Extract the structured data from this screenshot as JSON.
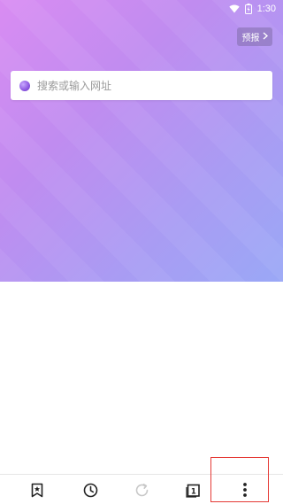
{
  "status_bar": {
    "time": "1:30",
    "icons": [
      "wifi-icon",
      "battery-icon"
    ]
  },
  "header": {
    "forecast_label": "预报",
    "forecast_icon": "chevron-right-icon"
  },
  "search": {
    "placeholder": "搜索或输入网址",
    "logo_icon": "purple-orb-icon"
  },
  "bottom_nav": {
    "items": [
      {
        "name": "bookmarks",
        "icon": "bookmark-star-icon",
        "enabled": true
      },
      {
        "name": "history",
        "icon": "clock-icon",
        "enabled": true
      },
      {
        "name": "refresh",
        "icon": "refresh-icon",
        "enabled": false
      },
      {
        "name": "tabs",
        "icon": "tabs-count-icon",
        "count": "1",
        "enabled": true
      },
      {
        "name": "menu",
        "icon": "more-vertical-icon",
        "enabled": true,
        "highlighted": true
      }
    ]
  },
  "colors": {
    "gradient_start": "#d98cf2",
    "gradient_end": "#9aa8f6",
    "highlight_border": "#e53935",
    "icon_active": "#222222",
    "icon_disabled": "#c8c8c8"
  }
}
